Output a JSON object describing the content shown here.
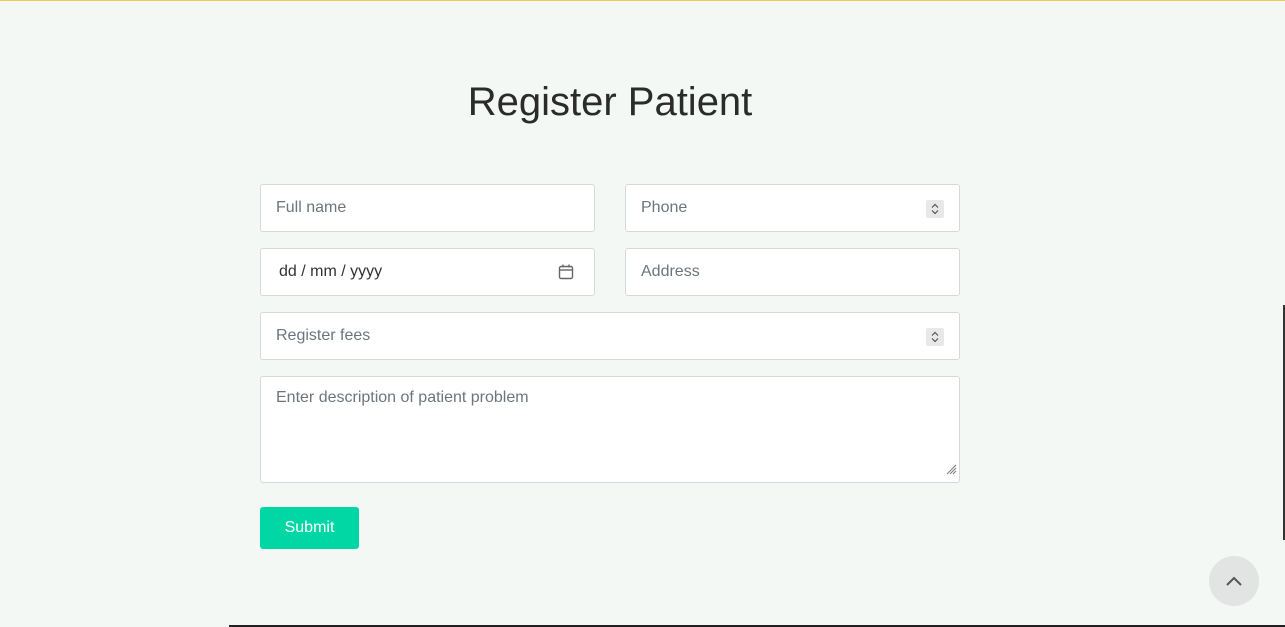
{
  "page": {
    "title": "Register Patient"
  },
  "form": {
    "full_name": {
      "placeholder": "Full name"
    },
    "phone": {
      "placeholder": "Phone"
    },
    "dob": {
      "display": "dd / mm / yyyy"
    },
    "address": {
      "placeholder": "Address"
    },
    "register_fees": {
      "placeholder": "Register fees"
    },
    "description": {
      "placeholder": "Enter description of patient problem"
    },
    "submit_label": "Submit"
  },
  "colors": {
    "accent": "#00d7a4",
    "background": "#f4f8f5"
  },
  "icons": {
    "calendar": "calendar-icon",
    "scroll_top": "chevron-up-icon",
    "spinner": "number-spinner-icon"
  }
}
